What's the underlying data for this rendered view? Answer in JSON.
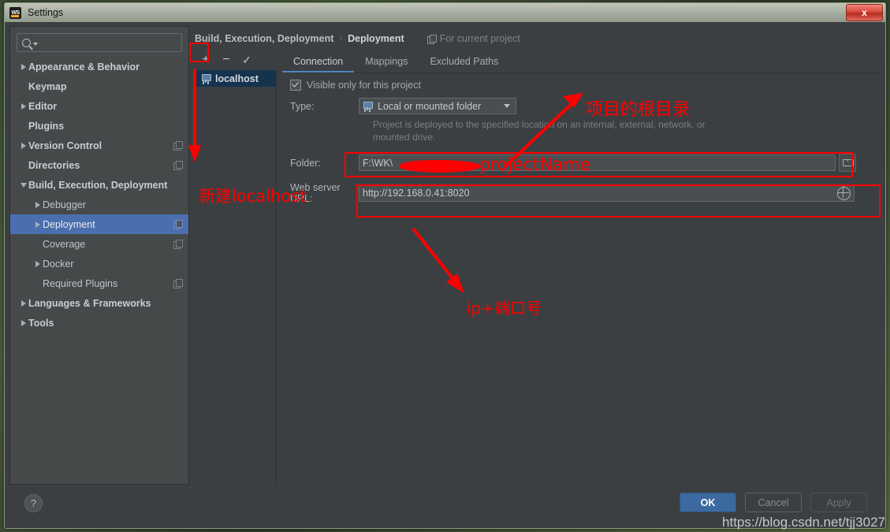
{
  "window": {
    "title": "Settings",
    "logo_text": "WS",
    "close_label": "x"
  },
  "search": {
    "placeholder": "",
    "value": "",
    "icon": "search-icon"
  },
  "sidebar": {
    "items": [
      {
        "label": "Appearance & Behavior",
        "twisty": "right",
        "indent": 0,
        "bold": true,
        "selected": false,
        "copy": false
      },
      {
        "label": "Keymap",
        "twisty": "none",
        "indent": 0,
        "bold": true,
        "selected": false,
        "copy": false
      },
      {
        "label": "Editor",
        "twisty": "right",
        "indent": 0,
        "bold": true,
        "selected": false,
        "copy": false
      },
      {
        "label": "Plugins",
        "twisty": "none",
        "indent": 0,
        "bold": true,
        "selected": false,
        "copy": false
      },
      {
        "label": "Version Control",
        "twisty": "right",
        "indent": 0,
        "bold": true,
        "selected": false,
        "copy": true
      },
      {
        "label": "Directories",
        "twisty": "none",
        "indent": 0,
        "bold": true,
        "selected": false,
        "copy": true
      },
      {
        "label": "Build, Execution, Deployment",
        "twisty": "down",
        "indent": 0,
        "bold": true,
        "selected": false,
        "copy": false
      },
      {
        "label": "Debugger",
        "twisty": "right",
        "indent": 1,
        "bold": false,
        "selected": false,
        "copy": false
      },
      {
        "label": "Deployment",
        "twisty": "right",
        "indent": 1,
        "bold": false,
        "selected": true,
        "copy": true
      },
      {
        "label": "Coverage",
        "twisty": "none",
        "indent": 1,
        "bold": false,
        "selected": false,
        "copy": true
      },
      {
        "label": "Docker",
        "twisty": "right",
        "indent": 1,
        "bold": false,
        "selected": false,
        "copy": false
      },
      {
        "label": "Required Plugins",
        "twisty": "none",
        "indent": 1,
        "bold": false,
        "selected": false,
        "copy": true
      },
      {
        "label": "Languages & Frameworks",
        "twisty": "right",
        "indent": 0,
        "bold": true,
        "selected": false,
        "copy": false
      },
      {
        "label": "Tools",
        "twisty": "right",
        "indent": 0,
        "bold": true,
        "selected": false,
        "copy": false
      }
    ]
  },
  "breadcrumb": {
    "parent": "Build, Execution, Deployment",
    "separator": "›",
    "current": "Deployment",
    "scope_label": "For current project"
  },
  "toolbar": {
    "add_label": "+",
    "remove_label": "−",
    "default_label": "✓"
  },
  "server_list": {
    "items": [
      {
        "name": "localhost",
        "selected": true
      }
    ]
  },
  "tabs": [
    {
      "label": "Connection",
      "active": true
    },
    {
      "label": "Mappings",
      "active": false
    },
    {
      "label": "Excluded Paths",
      "active": false
    }
  ],
  "form": {
    "visible_only_label": "Visible only for this project",
    "visible_only_checked": true,
    "type_label": "Type:",
    "type_value": "Local or mounted folder",
    "type_hint": "Project is deployed to the specified location on an internal, external, network, or mounted drive.",
    "folder_label": "Folder:",
    "folder_value": "F:\\WK\\",
    "url_label": "Web server URL:",
    "url_value": "http://192.168.0.41:8020"
  },
  "footer": {
    "help_label": "?",
    "ok_label": "OK",
    "cancel_label": "Cancel",
    "apply_label": "Apply"
  },
  "annotations": {
    "color": "#ff0000",
    "project_root": "项目的根目录",
    "new_localhost": "新建localhost",
    "ip_port": "ip+端口号",
    "project_name": "projectName"
  },
  "watermark": "https://blog.csdn.net/tjj3027"
}
